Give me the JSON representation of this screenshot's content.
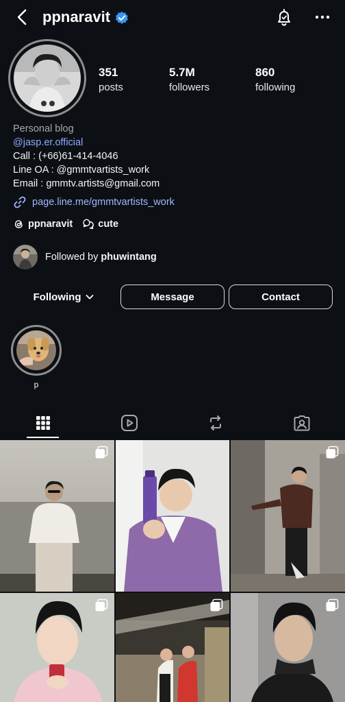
{
  "header": {
    "username": "ppnaravit"
  },
  "profile": {
    "stats": [
      {
        "value": "351",
        "label": "posts"
      },
      {
        "value": "5.7M",
        "label": "followers"
      },
      {
        "value": "860",
        "label": "following"
      }
    ],
    "bio": {
      "category": "Personal blog",
      "mention": "@jasp.er.official",
      "line_call": "Call : (+66)61-414-4046",
      "line_oa": "Line OA : @gmmtvartists_work",
      "line_email": "Email : gmmtv.artists@gmail.com",
      "link": "page.line.me/gmmtvartists_work"
    },
    "threads_handle": "ppnaravit",
    "channel_label": "cute",
    "followed_by_prefix": "Followed by ",
    "followed_by_user": "phuwintang"
  },
  "actions": {
    "following_label": "Following",
    "message_label": "Message",
    "contact_label": "Contact"
  },
  "highlights": [
    {
      "label": "p"
    }
  ],
  "tabs": [
    "grid-icon",
    "reels-icon",
    "reposts-icon",
    "tagged-icon"
  ],
  "colors": {
    "background": "#0c1014",
    "link": "#a3b5ff",
    "verified": "#3897f0"
  }
}
